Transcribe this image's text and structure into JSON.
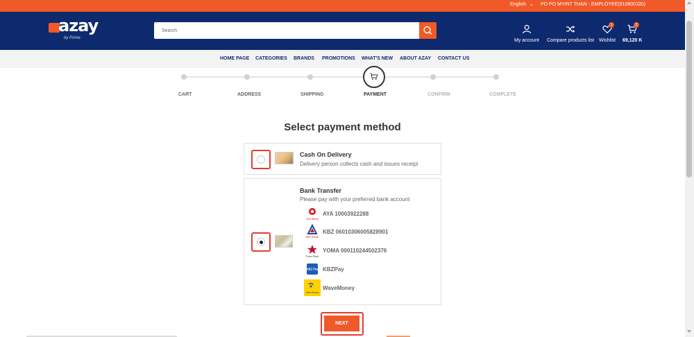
{
  "topbar": {
    "language": "English",
    "user": "PO PO MYINT THAN - EMPLOYEE(010800735)"
  },
  "header": {
    "logo_text": "azay",
    "logo_sub": "by Prime",
    "search_placeholder": "Search",
    "my_account": "My account",
    "compare": "Compare products list",
    "wishlist": "Wishlist",
    "wishlist_count": "1",
    "cart_total": "69,120 K",
    "cart_count": "2"
  },
  "nav": [
    "HOME PAGE",
    "CATEGORIES",
    "BRANDS",
    "PROMOTIONS",
    "WHAT'S NEW",
    "ABOUT AZAY",
    "CONTACT US"
  ],
  "steps": [
    "CART",
    "ADDRESS",
    "SHIPPING",
    "PAYMENT",
    "CONFIRM",
    "COMPLETE"
  ],
  "page_title": "Select payment method",
  "payment_methods": [
    {
      "title": "Cash On Delivery",
      "description": "Delivery person collects cash and issues receipt",
      "selected": false
    },
    {
      "title": "Bank Transfer",
      "description": "Please pay with your preferred bank account",
      "selected": true,
      "banks": [
        {
          "label": "AYA 10003922288",
          "logo_caption": "AYA Bank",
          "icon": "aya-bank-logo"
        },
        {
          "label": "KBZ 06010306005828901",
          "logo_caption": "KBZ BANK",
          "icon": "kbz-bank-logo"
        },
        {
          "label": "YOMA 000110244502376",
          "logo_caption": "Yoma Bank",
          "icon": "yoma-bank-logo"
        },
        {
          "label": "KBZPay",
          "logo_caption": "KBZ Pay",
          "icon": "kbzpay-logo"
        },
        {
          "label": "WaveMoney",
          "logo_caption": "Wave Money",
          "icon": "wavemoney-logo"
        }
      ]
    }
  ],
  "next_label": "NEXT",
  "colors": {
    "accent": "#f05a28",
    "navy": "#0e2a6e",
    "highlight": "#e33b33"
  }
}
